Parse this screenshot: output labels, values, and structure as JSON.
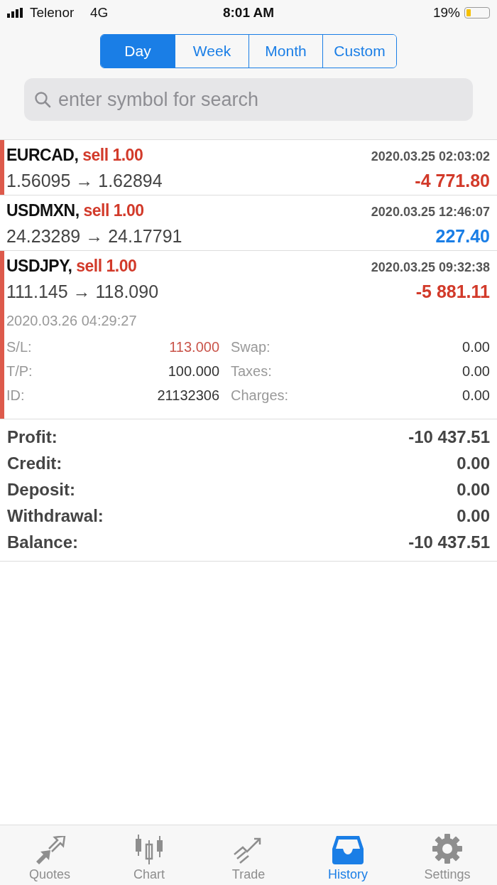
{
  "status_bar": {
    "carrier": "Telenor",
    "network": "4G",
    "time": "8:01 AM",
    "battery": "19%"
  },
  "periods": [
    {
      "label": "Day",
      "selected": true
    },
    {
      "label": "Week",
      "selected": false
    },
    {
      "label": "Month",
      "selected": false
    },
    {
      "label": "Custom",
      "selected": false
    }
  ],
  "search": {
    "placeholder": "enter symbol for search"
  },
  "deals": [
    {
      "symbol": "EURCAD,",
      "side": "sell 1.00",
      "time": "2020.03.25 02:03:02",
      "prices": "1.56095 → 1.62894",
      "profit": "-4 771.80",
      "kind": "loss",
      "expanded": false
    },
    {
      "symbol": "USDMXN,",
      "side": "sell 1.00",
      "time": "2020.03.25 12:46:07",
      "prices": "24.23289 → 24.17791",
      "profit": "227.40",
      "kind": "gain",
      "expanded": false
    },
    {
      "symbol": "USDJPY,",
      "side": "sell 1.00",
      "time": "2020.03.25 09:32:38",
      "prices": "111.145 → 118.090",
      "profit": "-5 881.11",
      "kind": "loss",
      "expanded": true,
      "close_time": "2020.03.26 04:29:27",
      "details": [
        {
          "label": "S/L:",
          "value": "113.000",
          "alert": true
        },
        {
          "label": "Swap:",
          "value": "0.00",
          "alert": false
        },
        {
          "label": "T/P:",
          "value": "100.000",
          "alert": false
        },
        {
          "label": "Taxes:",
          "value": "0.00",
          "alert": false
        },
        {
          "label": "ID:",
          "value": "21132306",
          "alert": false
        },
        {
          "label": "Charges:",
          "value": "0.00",
          "alert": false
        }
      ]
    }
  ],
  "summary": [
    {
      "label": "Profit:",
      "value": "-10 437.51"
    },
    {
      "label": "Credit:",
      "value": "0.00"
    },
    {
      "label": "Deposit:",
      "value": "0.00"
    },
    {
      "label": "Withdrawal:",
      "value": "0.00"
    },
    {
      "label": "Balance:",
      "value": "-10 437.51"
    }
  ],
  "tabs": [
    {
      "label": "Quotes",
      "kind": "quotes",
      "selected": false
    },
    {
      "label": "Chart",
      "kind": "chart",
      "selected": false
    },
    {
      "label": "Trade",
      "kind": "trade",
      "selected": false
    },
    {
      "label": "History",
      "kind": "history",
      "selected": true
    },
    {
      "label": "Settings",
      "kind": "settings",
      "selected": false
    }
  ]
}
